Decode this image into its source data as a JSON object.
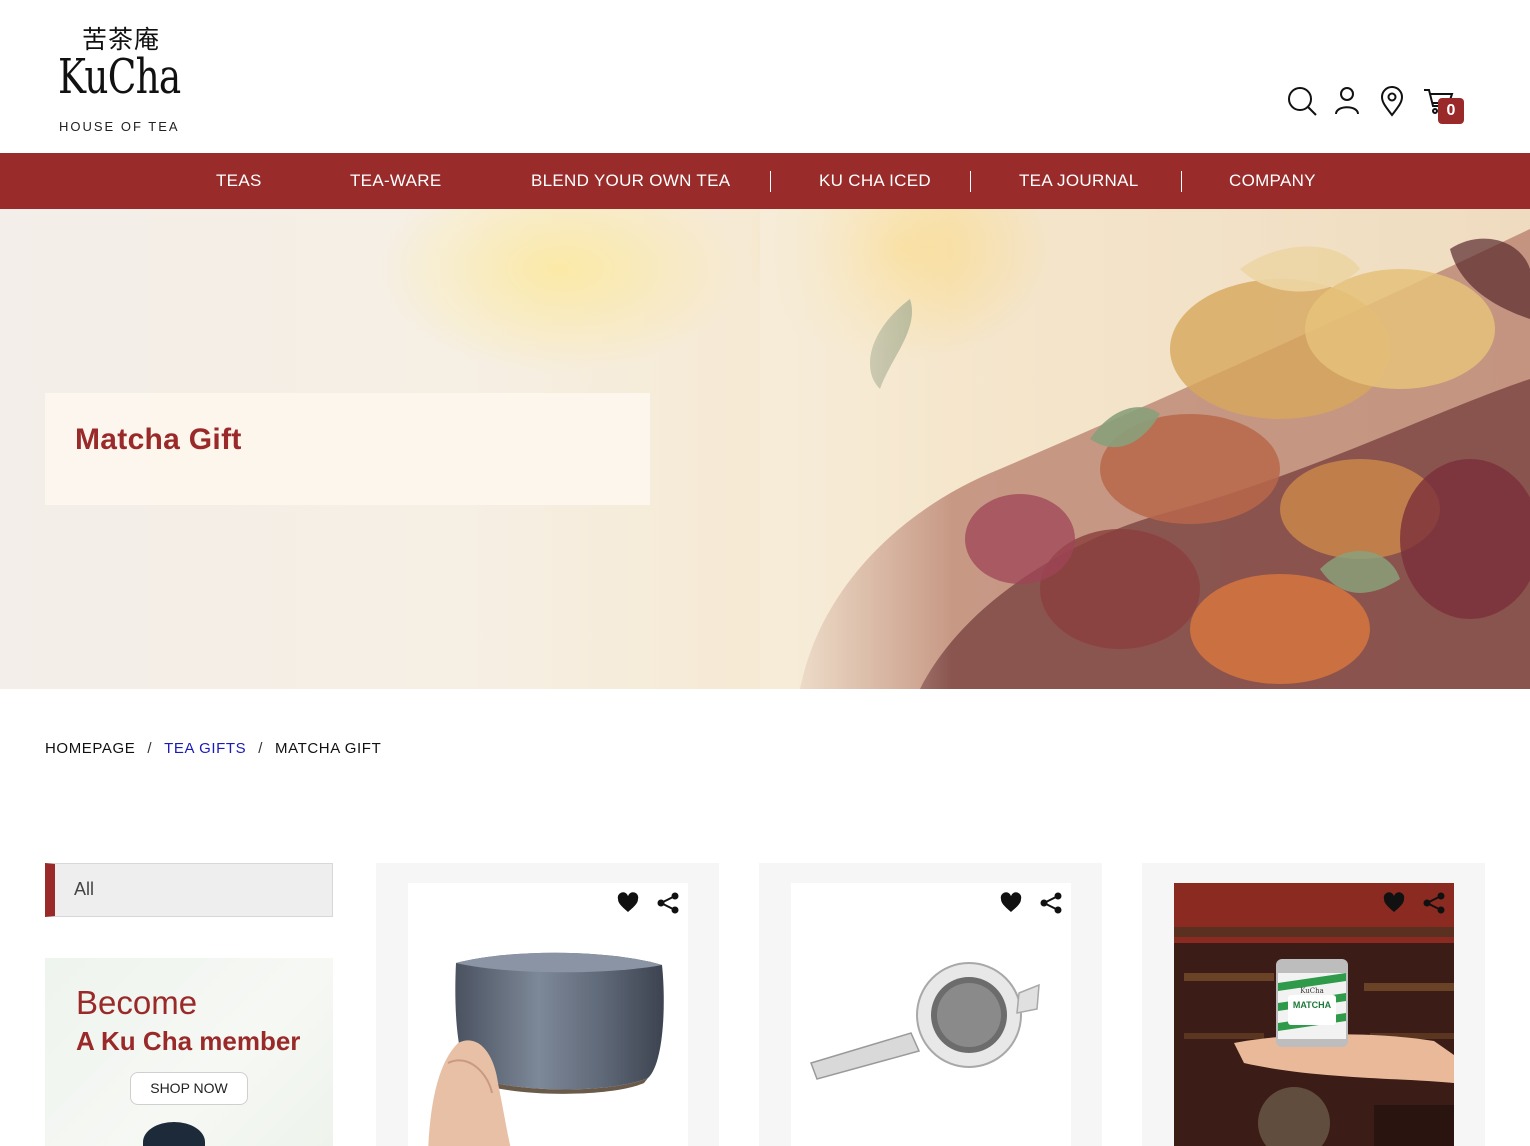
{
  "header": {
    "logo": {
      "cjk": "苦茶庵",
      "brand": "KuCha",
      "tagline": "HOUSE OF TEA"
    },
    "icons": [
      "search-icon",
      "account-icon",
      "location-icon",
      "cart-icon"
    ],
    "cart_count": "0"
  },
  "nav": {
    "items": [
      {
        "label": "TEAS"
      },
      {
        "label": "TEA-WARE"
      },
      {
        "label": "BLEND YOUR OWN TEA"
      },
      {
        "label": "KU CHA ICED"
      },
      {
        "label": "TEA JOURNAL"
      },
      {
        "label": "COMPANY"
      }
    ]
  },
  "hero": {
    "title": "Matcha Gift"
  },
  "breadcrumb": {
    "items": [
      {
        "label": "HOMEPAGE"
      },
      {
        "label": "TEA GIFTS"
      },
      {
        "label": "MATCHA GIFT"
      }
    ],
    "separator": "/"
  },
  "sidebar": {
    "filter_label": "All",
    "promo": {
      "line1": "Become",
      "line2": "A Ku Cha member",
      "button": "SHOP NOW"
    }
  },
  "products": [
    {
      "image": "matcha-bowl-in-hand",
      "actions": [
        "heart-icon",
        "share-icon"
      ]
    },
    {
      "image": "tea-strainer",
      "actions": [
        "heart-icon",
        "share-icon"
      ]
    },
    {
      "image": "matcha-tin-in-hand",
      "tin_label": "MATCHA",
      "tin_brand": "KuCha",
      "actions": [
        "heart-icon",
        "share-icon"
      ]
    }
  ],
  "colors": {
    "brand_red": "#992b2b",
    "link_blue": "#1a1ab8"
  }
}
